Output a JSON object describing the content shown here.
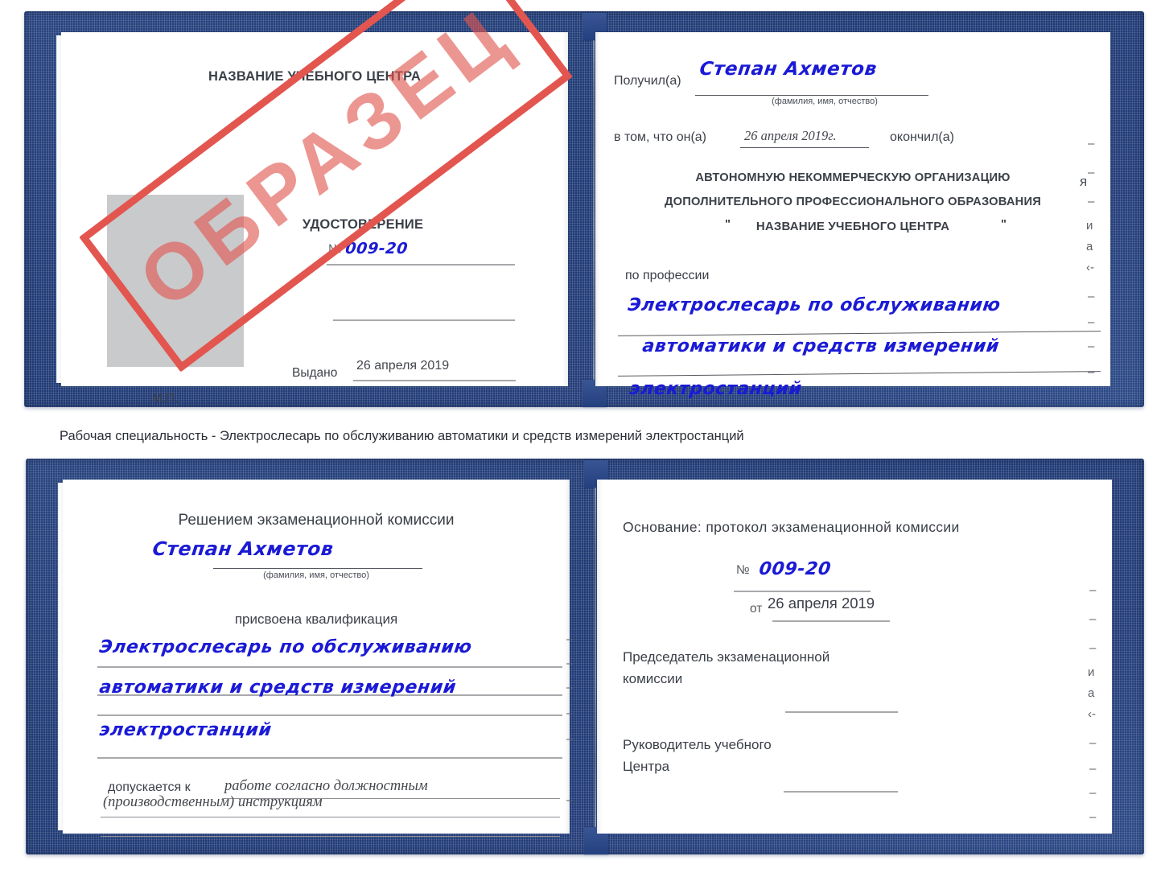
{
  "caption": {
    "text": "Рабочая специальность - Электрослесарь по обслуживанию автоматики и средств измерений электростанций"
  },
  "stamp": {
    "label": "ОБРАЗЕЦ",
    "color": "#e2564f"
  },
  "colors": {
    "cover_blue": "#233c78",
    "cover_blue_light": "#2c4a88",
    "ink_blue": "#1a1ad6",
    "page_white": "#ffffff",
    "photo_gray": "#c8cacc",
    "rule_gray": "#a7a9ac",
    "text_gray": "#3b3f47"
  },
  "certificate_top": {
    "left_page": {
      "title": "НАЗВАНИЕ УЧЕБНОГО ЦЕНТРА",
      "doc_type": "УДОСТОВЕРЕНИЕ",
      "number_label": "№",
      "number_value": "009-20",
      "issued_label": "Выдано",
      "issued_value": "26 апреля 2019",
      "seal_label": "М.П.",
      "photo_placeholder": "photo-box"
    },
    "right_page": {
      "received_label": "Получил(а)",
      "received_value": "Степан Ахметов",
      "name_hint": "(фамилия, имя, отчество)",
      "that_he_label": "в том, что он(а)",
      "that_he_value": "26 апреля 2019г.",
      "finished_label": "окончил(а)",
      "org_line1": "АВТОНОМНУЮ НЕКОММЕРЧЕСКУЮ ОРГАНИЗАЦИЮ",
      "org_line2": "ДОПОЛНИТЕЛЬНОГО ПРОФЕССИОНАЛЬНОГО ОБРАЗОВАНИЯ",
      "org_quote_open": "\"",
      "org_line3": "НАЗВАНИЕ УЧЕБНОГО ЦЕНТРА",
      "org_quote_close": "\"",
      "profession_label": "по профессии",
      "profession_line1": "Электрослесарь по обслуживанию",
      "profession_line2": "автоматики и средств измерений",
      "profession_line3": "электростанций",
      "edge_bleed": [
        "–",
        "–",
        "–",
        "и",
        "а",
        "‹-",
        "–",
        "–",
        "–",
        "–"
      ]
    }
  },
  "certificate_bottom": {
    "left_page": {
      "heading": "Решением экзаменационной комиссии",
      "name_value": "Степан Ахметов",
      "name_hint": "(фамилия, имя, отчество)",
      "qualification_label": "присвоена квалификация",
      "qualification_line1": "Электрослесарь по обслуживанию",
      "qualification_line2": "автоматики и средств измерений",
      "qualification_line3": "электростанций",
      "admitted_label": "допускается к",
      "admitted_line1": "работе согласно должностным",
      "admitted_line2": "(производственным) инструкциям"
    },
    "right_page": {
      "basis_label": "Основание: протокол экзаменационной комиссии",
      "number_label": "№",
      "number_value": "009-20",
      "date_label": "от",
      "date_value": "26 апреля 2019",
      "chairman_line1": "Председатель экзаменационной",
      "chairman_line2": "комиссии",
      "head_line1": "Руководитель учебного",
      "head_line2": "Центра",
      "edge_bleed": [
        "–",
        "–",
        "–",
        "и",
        "а",
        "‹-",
        "–",
        "–",
        "–",
        "–"
      ]
    }
  }
}
